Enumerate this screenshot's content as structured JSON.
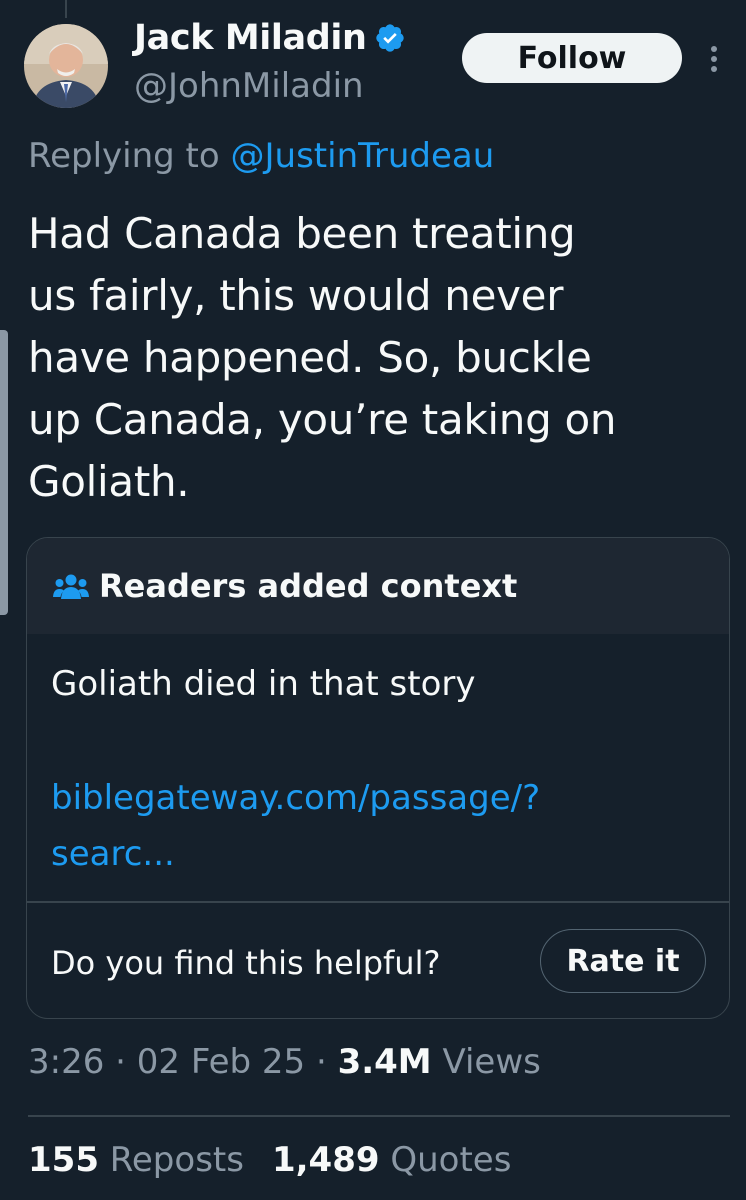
{
  "author": {
    "display_name": "Jack Miladin",
    "handle": "@JohnMiladin",
    "verified": true
  },
  "follow_label": "Follow",
  "replying": {
    "prefix": "Replying to",
    "mention": "@JustinTrudeau"
  },
  "tweet_lines": [
    "Had Canada been treating",
    "us fairly, this would never",
    "have happened. So, buckle",
    "up Canada, you’re taking on",
    "Goliath."
  ],
  "community_note": {
    "title": "Readers added context",
    "body": "Goliath died in that story",
    "link_lines": [
      "biblegateway.com/passage/?",
      "searc..."
    ],
    "helpful_prompt": "Do you find this helpful?",
    "rate_label": "Rate it"
  },
  "meta": {
    "time": "3:26",
    "date": "02 Feb 25",
    "views_count": "3.4M",
    "views_label": "Views",
    "separator": "·"
  },
  "stats": {
    "reposts_count": "155",
    "reposts_label": "Reposts",
    "quotes_count": "1,489",
    "quotes_label": "Quotes"
  },
  "colors": {
    "background": "#15202b",
    "accent": "#1d9bf0",
    "secondary_text": "#8b98a5"
  }
}
